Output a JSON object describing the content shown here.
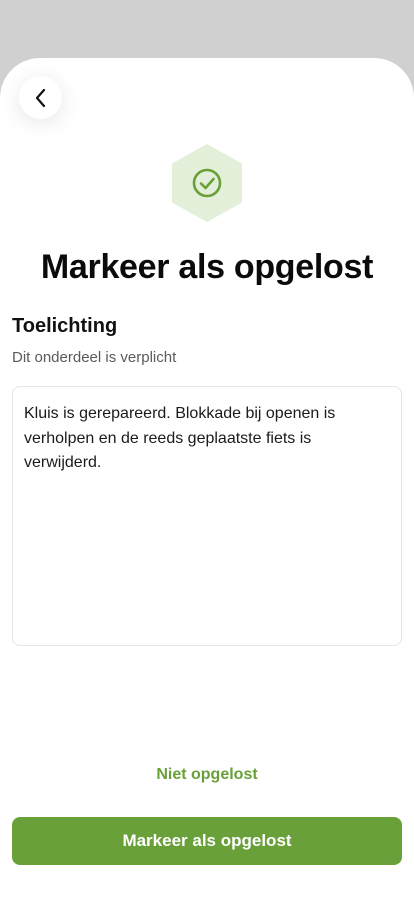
{
  "header": {
    "back_icon": "chevron-left-icon"
  },
  "status_icon": {
    "name": "check-circle-icon",
    "hex_color": "#e3efd9",
    "accent_color": "#6aa039"
  },
  "page": {
    "title": "Markeer als opgelost"
  },
  "explanation": {
    "label": "Toelichting",
    "hint": "Dit onderdeel is verplicht",
    "value": "Kluis is gerepareerd. Blokkade bij openen is verholpen en de reeds geplaatste fiets is verwijderd."
  },
  "actions": {
    "secondary_label": "Niet opgelost",
    "primary_label": "Markeer als opgelost"
  }
}
